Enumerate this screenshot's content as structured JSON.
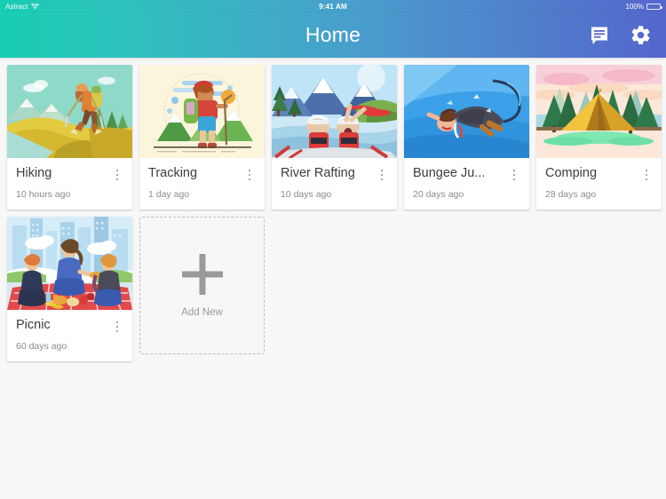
{
  "status_bar": {
    "carrier": "Astract",
    "wifi_icon": "wifi-icon",
    "time": "9:41 AM",
    "battery_percent": "100%",
    "battery_icon": "battery-full-icon"
  },
  "header": {
    "title": "Home",
    "gradient_start": "#17cdb4",
    "gradient_end": "#5566cc",
    "actions": [
      {
        "name": "messages-icon",
        "label": "Messages"
      },
      {
        "name": "settings-gear-icon",
        "label": "Settings"
      }
    ]
  },
  "grid": {
    "cards": [
      {
        "title": "Hiking",
        "time": "10 hours ago",
        "thumb": "hiking-illustration",
        "menu_icon": "kebab-menu-icon"
      },
      {
        "title": "Tracking",
        "time": "1 day ago",
        "thumb": "tracking-illustration",
        "menu_icon": "kebab-menu-icon"
      },
      {
        "title": "River Rafting",
        "time": "10 days ago",
        "thumb": "rafting-illustration",
        "menu_icon": "kebab-menu-icon"
      },
      {
        "title": "Bungee Ju...",
        "time": "20 days ago",
        "thumb": "bungee-illustration",
        "menu_icon": "kebab-menu-icon"
      },
      {
        "title": "Comping",
        "time": "28 days ago",
        "thumb": "camping-illustration",
        "menu_icon": "kebab-menu-icon"
      },
      {
        "title": "Picnic",
        "time": "60 days ago",
        "thumb": "picnic-illustration",
        "menu_icon": "kebab-menu-icon"
      }
    ],
    "add_new": {
      "label": "Add New",
      "icon": "plus-icon"
    }
  },
  "colors": {
    "page_background": "#f7f7f7",
    "card_background": "#ffffff",
    "title_text": "#3c3c3c",
    "secondary_text": "#8a8a8a"
  }
}
